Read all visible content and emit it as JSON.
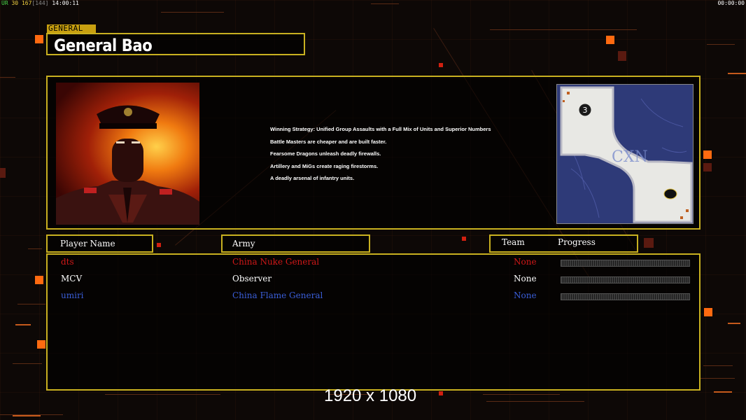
{
  "hud": {
    "fps_label": "ÜR",
    "fps": "30",
    "frame": "167",
    "frame_sub": "[144]",
    "clock": "14:00:11",
    "timer": "00:00:00"
  },
  "general": {
    "tag": "GENERAL",
    "name": "General Bao",
    "portrait": "general-bao-portrait"
  },
  "strategy": [
    "Winning Strategy: Unified Group Assaults with a Full Mix of Units and Superior Numbers",
    "Battle Masters are cheaper and are built faster.",
    "Fearsome Dragons unleash deadly firewalls.",
    "Artillery and MiGs create raging firestorms.",
    "A deadly arsenal of infantry units."
  ],
  "minimap": {
    "start_marker": "3",
    "map_text": "CXN",
    "water_color": "#2e3a78",
    "land_color": "#e8e8e4"
  },
  "table_headers": {
    "player": "Player Name",
    "army": "Army",
    "team": "Team",
    "progress": "Progress"
  },
  "players": [
    {
      "name": "dts",
      "army": "China Nuke General",
      "team": "None",
      "color": "#d01818"
    },
    {
      "name": "MCV",
      "army": "Observer",
      "team": "None",
      "color": "#ffffff"
    },
    {
      "name": "umiri",
      "army": "China Flame General",
      "team": "None",
      "color": "#3a5ed8"
    }
  ],
  "resolution": "1920 x 1080",
  "colors": {
    "frame": "#c8b020",
    "accent": "#ff6a10"
  }
}
